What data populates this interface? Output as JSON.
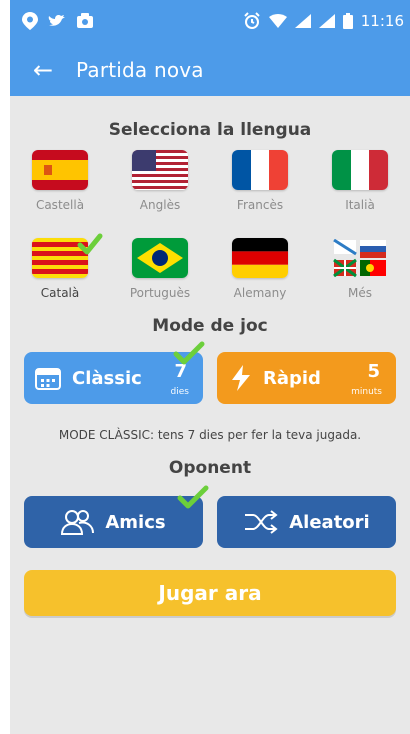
{
  "status": {
    "time": "11:16"
  },
  "app": {
    "title": "Partida nova",
    "back_label": "←"
  },
  "sections": {
    "language_title": "Selecciona la llengua",
    "mode_title": "Mode de joc",
    "opponent_title": "Oponent"
  },
  "languages": [
    {
      "name": "Castellà",
      "icon": "spain-flag-icon",
      "selected": false
    },
    {
      "name": "Anglès",
      "icon": "usa-flag-icon",
      "selected": false
    },
    {
      "name": "Francès",
      "icon": "france-flag-icon",
      "selected": false
    },
    {
      "name": "Italià",
      "icon": "italy-flag-icon",
      "selected": false
    },
    {
      "name": "Català",
      "icon": "catalonia-flag-icon",
      "selected": true
    },
    {
      "name": "Portuguès",
      "icon": "brazil-flag-icon",
      "selected": false
    },
    {
      "name": "Alemany",
      "icon": "germany-flag-icon",
      "selected": false
    },
    {
      "name": "Més",
      "icon": "more-flags-icon",
      "selected": false
    }
  ],
  "modes": {
    "classic": {
      "label": "Clàssic",
      "value": "7",
      "unit": "dies",
      "selected": true
    },
    "rapid": {
      "label": "Ràpid",
      "value": "5",
      "unit": "minuts",
      "selected": false
    }
  },
  "mode_description": "MODE CLÀSSIC: tens 7 dies per fer la teva jugada.",
  "opponents": {
    "friends": {
      "label": "Amics",
      "selected": true
    },
    "random": {
      "label": "Aleatori",
      "selected": false
    }
  },
  "play_button": "Jugar ara",
  "colors": {
    "primary_blue": "#4d9be9",
    "dark_blue": "#2f63a8",
    "orange": "#f39a1d",
    "yellow": "#f6c12c",
    "green_check": "#6ccf3b",
    "background": "#e8e8e8"
  }
}
